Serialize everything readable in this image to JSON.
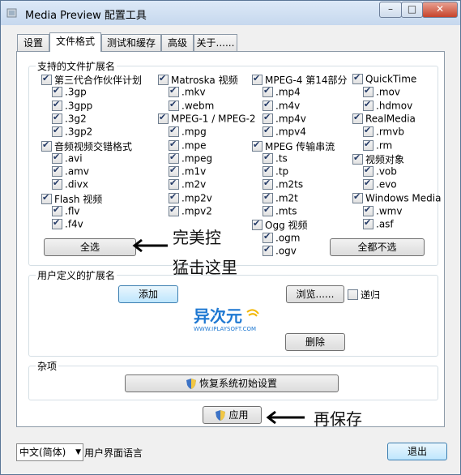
{
  "window": {
    "title": "Media Preview 配置工具",
    "min": "–",
    "max": "□",
    "close": "✕"
  },
  "tabs": [
    {
      "label": "设置"
    },
    {
      "label": "文件格式"
    },
    {
      "label": "测试和缓存"
    },
    {
      "label": "高级"
    },
    {
      "label": "关于......"
    }
  ],
  "supported": {
    "title": "支持的文件扩展名",
    "col1": [
      {
        "label": "第三代合作伙伴计划",
        "checked": true,
        "group": true
      },
      {
        "label": ".3gp",
        "checked": true
      },
      {
        "label": ".3gpp",
        "checked": true
      },
      {
        "label": ".3g2",
        "checked": true
      },
      {
        "label": ".3gp2",
        "checked": true
      },
      {
        "label": "音频视频交错格式",
        "checked": true,
        "group": true
      },
      {
        "label": ".avi",
        "checked": true
      },
      {
        "label": ".amv",
        "checked": true
      },
      {
        "label": ".divx",
        "checked": true
      },
      {
        "label": "Flash 视频",
        "checked": true,
        "group": true
      },
      {
        "label": ".flv",
        "checked": true
      },
      {
        "label": ".f4v",
        "checked": true
      }
    ],
    "col2": [
      {
        "label": "Matroska 视频",
        "checked": true,
        "group": true
      },
      {
        "label": ".mkv",
        "checked": true
      },
      {
        "label": ".webm",
        "checked": true
      },
      {
        "label": "MPEG-1 / MPEG-2",
        "checked": true,
        "group": true
      },
      {
        "label": ".mpg",
        "checked": true
      },
      {
        "label": ".mpe",
        "checked": true
      },
      {
        "label": ".mpeg",
        "checked": true
      },
      {
        "label": ".m1v",
        "checked": true
      },
      {
        "label": ".m2v",
        "checked": true
      },
      {
        "label": ".mp2v",
        "checked": true
      },
      {
        "label": ".mpv2",
        "checked": true
      }
    ],
    "col3": [
      {
        "label": "MPEG-4 第14部分",
        "checked": true,
        "group": true
      },
      {
        "label": ".mp4",
        "checked": true
      },
      {
        "label": ".m4v",
        "checked": true
      },
      {
        "label": ".mp4v",
        "checked": true
      },
      {
        "label": ".mpv4",
        "checked": true
      },
      {
        "label": "MPEG 传输串流",
        "checked": true,
        "group": true
      },
      {
        "label": ".ts",
        "checked": true
      },
      {
        "label": ".tp",
        "checked": true
      },
      {
        "label": ".m2ts",
        "checked": true
      },
      {
        "label": ".m2t",
        "checked": true
      },
      {
        "label": ".mts",
        "checked": true
      },
      {
        "label": "Ogg 视频",
        "checked": true,
        "group": true
      },
      {
        "label": ".ogm",
        "checked": true
      },
      {
        "label": ".ogv",
        "checked": true
      }
    ],
    "col4": [
      {
        "label": "QuickTime",
        "checked": true,
        "group": true
      },
      {
        "label": ".mov",
        "checked": true
      },
      {
        "label": ".hdmov",
        "checked": true
      },
      {
        "label": "RealMedia",
        "checked": true,
        "group": true
      },
      {
        "label": ".rmvb",
        "checked": true
      },
      {
        "label": ".rm",
        "checked": true
      },
      {
        "label": "视频对象",
        "checked": true,
        "group": true
      },
      {
        "label": ".vob",
        "checked": true
      },
      {
        "label": ".evo",
        "checked": true
      },
      {
        "label": "Windows Media",
        "checked": true,
        "group": true
      },
      {
        "label": ".wmv",
        "checked": true
      },
      {
        "label": ".asf",
        "checked": true
      }
    ],
    "select_all": "全选",
    "select_none": "全都不选"
  },
  "user_defined": {
    "title": "用户定义的扩展名",
    "add": "添加",
    "browse": "浏览......",
    "recursive": "递归",
    "recursive_checked": false,
    "delete": "删除"
  },
  "misc": {
    "title": "杂项",
    "restore": "恢复系统初始设置"
  },
  "apply": "应用",
  "annotations": {
    "line1": "完美控",
    "line2": "猛击这里",
    "line3": "再保存"
  },
  "watermark": {
    "brand": "异次元",
    "site": "WWW.IPLAYSOFT.COM"
  },
  "footer": {
    "language": "中文(简体)",
    "language_label": "用户界面语言",
    "exit": "退出"
  },
  "colors": {
    "watermark_blue": "#1e78d2",
    "watermark_yellow": "#f2b705"
  }
}
